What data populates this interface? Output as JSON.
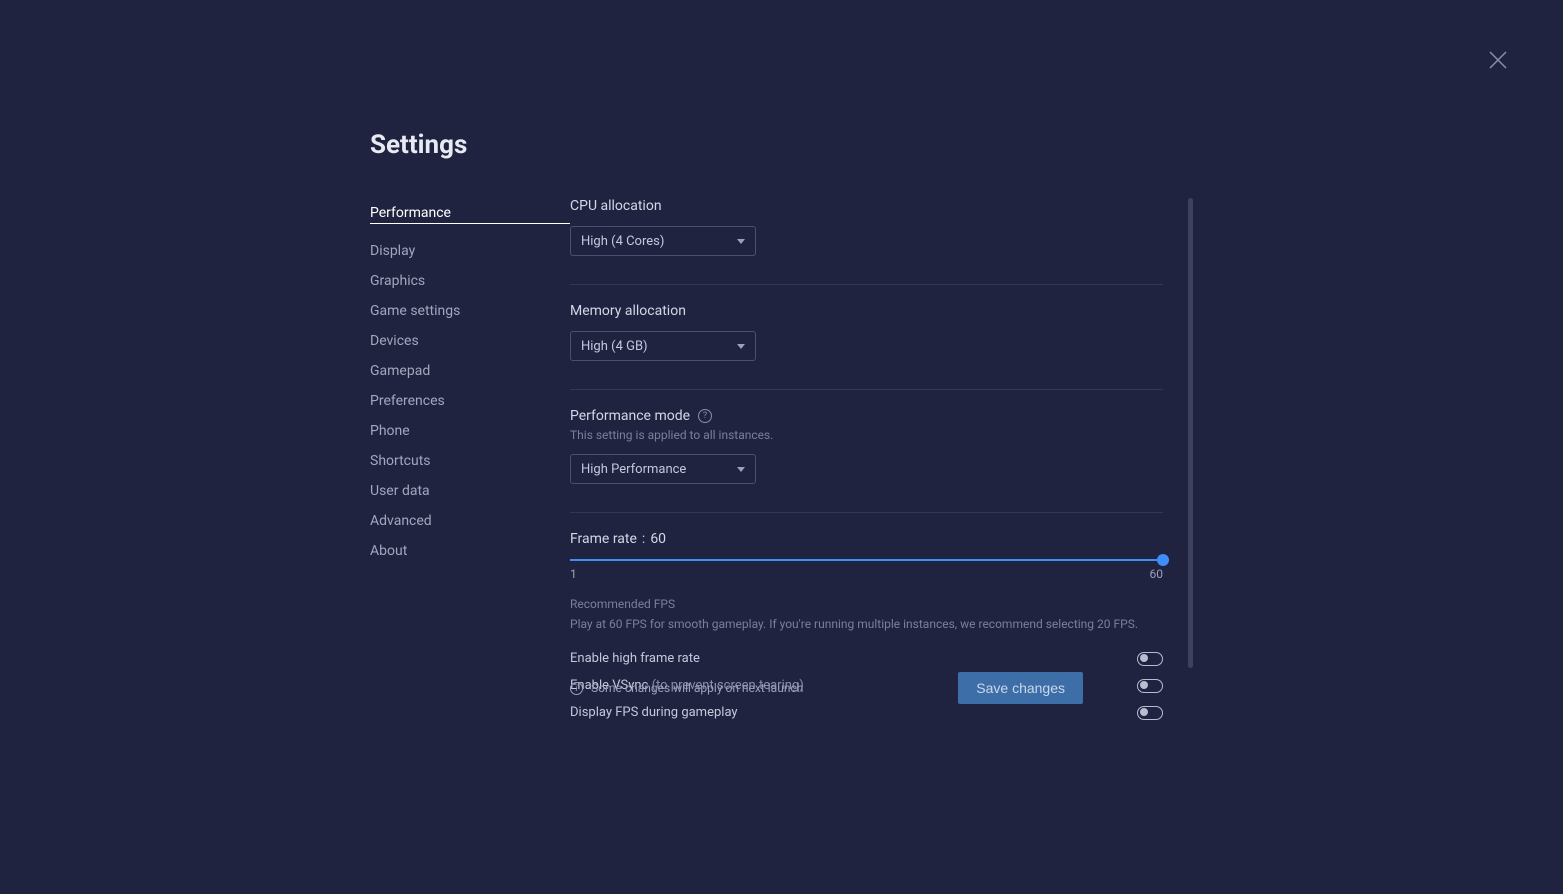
{
  "page_title": "Settings",
  "close_label": "close",
  "sidebar": {
    "items": [
      {
        "label": "Performance",
        "active": true
      },
      {
        "label": "Display",
        "active": false
      },
      {
        "label": "Graphics",
        "active": false
      },
      {
        "label": "Game settings",
        "active": false
      },
      {
        "label": "Devices",
        "active": false
      },
      {
        "label": "Gamepad",
        "active": false
      },
      {
        "label": "Preferences",
        "active": false
      },
      {
        "label": "Phone",
        "active": false
      },
      {
        "label": "Shortcuts",
        "active": false
      },
      {
        "label": "User data",
        "active": false
      },
      {
        "label": "Advanced",
        "active": false
      },
      {
        "label": "About",
        "active": false
      }
    ]
  },
  "main": {
    "cpu": {
      "label": "CPU allocation",
      "value": "High (4 Cores)"
    },
    "memory": {
      "label": "Memory allocation",
      "value": "High (4 GB)"
    },
    "perf_mode": {
      "label": "Performance mode",
      "hint": "This setting is applied to all instances.",
      "value": "High Performance"
    },
    "framerate": {
      "label": "Frame rate",
      "value": "60",
      "min": "1",
      "max": "60",
      "rec_title": "Recommended FPS",
      "rec_text": "Play at 60 FPS for smooth gameplay. If you're running multiple instances, we recommend selecting 20 FPS."
    },
    "toggles": {
      "high_fps": {
        "label": "Enable high frame rate",
        "on": false
      },
      "vsync": {
        "label": "Enable VSync",
        "hint": "(to prevent screen tearing)",
        "on": false
      },
      "display_fps": {
        "label": "Display FPS during gameplay",
        "on": false
      }
    }
  },
  "footer": {
    "note": "Some changes will apply on next launch",
    "save_label": "Save changes"
  }
}
